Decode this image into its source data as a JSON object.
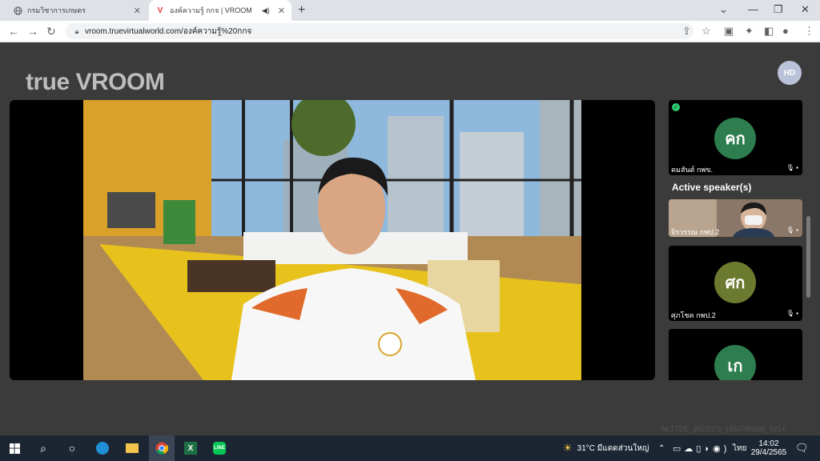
{
  "browser": {
    "tabs": [
      {
        "title": "กรมวิชาการเกษตร",
        "icon": "globe-icon"
      },
      {
        "title": "องค์ความรู้ กกจ | VROOM",
        "icon": "vroom-logo-icon",
        "audio": "speaker-icon"
      }
    ],
    "new_tab": "+",
    "url": "vroom.truevirtualworld.com/องค์ความรู้%20กกจ"
  },
  "app": {
    "logo": "true VROOM",
    "user_initials": "HD"
  },
  "participants": {
    "top": {
      "initials": "คก",
      "name": "คมสันต์ กพข.",
      "avatar_color": "#2e7d4f"
    },
    "active_label": "Active speaker(s)",
    "active": {
      "name": "จิรวรรณ กพป.2"
    },
    "third": {
      "initials": "ศก",
      "name": "ศุภโชค กพป.2",
      "avatar_color": "#6b7a2f"
    },
    "fourth": {
      "initials": "เก",
      "avatar_color": "#2e7d4f"
    }
  },
  "watermark": "NLTTDE_2022073_1650786000_0214",
  "taskbar": {
    "weather": "31°C  มีแดดส่วนใหญ่",
    "lang": "ไทย",
    "time": "14:02",
    "date": "29/4/2565"
  }
}
